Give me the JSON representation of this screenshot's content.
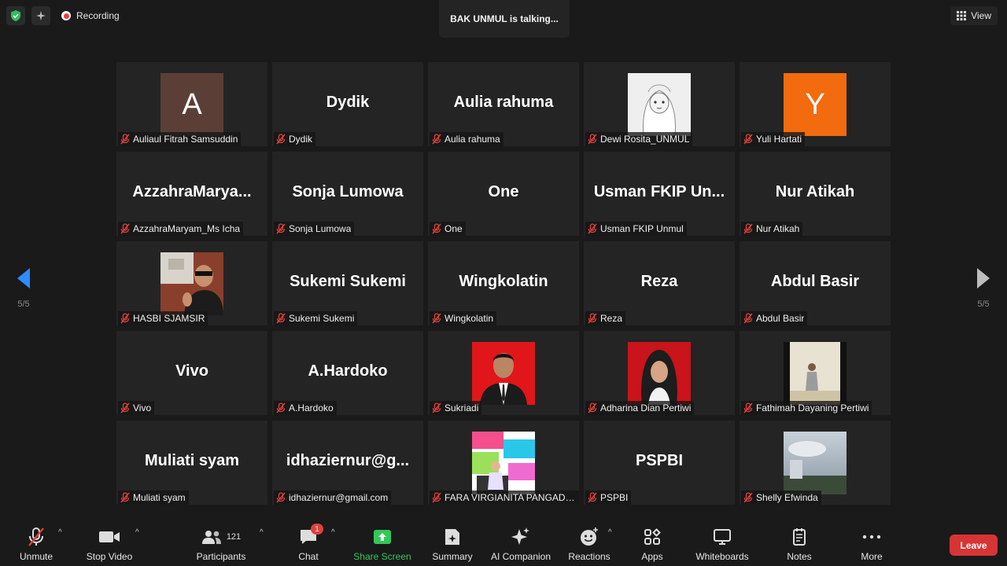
{
  "top": {
    "recording_label": "Recording",
    "talking_text": "BAK UNMUL is talking...",
    "view_label": "View"
  },
  "navigation": {
    "prev_page": "5/5",
    "next_page": "5/5"
  },
  "participants": [
    {
      "display": "A",
      "name": "Auliaul Fitrah Samsuddin",
      "avatar_type": "letter",
      "avatar_color": "#5b3f36"
    },
    {
      "display": "Dydik",
      "name": "Dydik"
    },
    {
      "display": "Aulia rahuma",
      "name": "Aulia rahuma"
    },
    {
      "display": "",
      "name": "Dewi Rosita_UNMUL",
      "avatar_type": "photo-sketch"
    },
    {
      "display": "Y",
      "name": "Yuli Hartati",
      "avatar_type": "letter",
      "avatar_color": "#f26b0f"
    },
    {
      "display": "AzzahraMarya...",
      "name": "AzzahraMaryam_Ms Icha"
    },
    {
      "display": "Sonja Lumowa",
      "name": "Sonja Lumowa"
    },
    {
      "display": "One",
      "name": "One"
    },
    {
      "display": "Usman FKIP Un...",
      "name": "Usman FKIP Unmul"
    },
    {
      "display": "Nur Atikah",
      "name": "Nur Atikah"
    },
    {
      "display": "",
      "name": "HASBI SJAMSIR",
      "avatar_type": "photo-man"
    },
    {
      "display": "Sukemi Sukemi",
      "name": "Sukemi Sukemi"
    },
    {
      "display": "Wingkolatin",
      "name": "Wingkolatin"
    },
    {
      "display": "Reza",
      "name": "Reza"
    },
    {
      "display": "Abdul Basir",
      "name": "Abdul Basir"
    },
    {
      "display": "Vivo",
      "name": "Vivo"
    },
    {
      "display": "A.Hardoko",
      "name": "A.Hardoko"
    },
    {
      "display": "",
      "name": "Sukriadi",
      "avatar_type": "photo-red-man"
    },
    {
      "display": "",
      "name": "Adharina Dian Pertiwi",
      "avatar_type": "photo-red-woman"
    },
    {
      "display": "",
      "name": "Fathimah Dayaning Pertiwi",
      "avatar_type": "photo-standing"
    },
    {
      "display": "Muliati syam",
      "name": "Muliati syam"
    },
    {
      "display": "idhaziernur@g...",
      "name": "idhaziernur@gmail.com"
    },
    {
      "display": "",
      "name": "FARA VIRGIANITA PANGADO...",
      "avatar_type": "photo-collage"
    },
    {
      "display": "PSPBI",
      "name": "PSPBI"
    },
    {
      "display": "",
      "name": "Shelly Efwinda",
      "avatar_type": "photo-sky"
    }
  ],
  "toolbar": {
    "unmute": "Unmute",
    "stop_video": "Stop Video",
    "participants": "Participants",
    "participants_count": "121",
    "chat": "Chat",
    "chat_badge": "1",
    "share_screen": "Share Screen",
    "summary": "Summary",
    "ai_companion": "AI Companion",
    "reactions": "Reactions",
    "apps": "Apps",
    "whiteboards": "Whiteboards",
    "notes": "Notes",
    "more": "More",
    "leave": "Leave"
  },
  "colors": {
    "leave": "#d73535",
    "share": "#34c759",
    "muted": "#e0413c"
  }
}
